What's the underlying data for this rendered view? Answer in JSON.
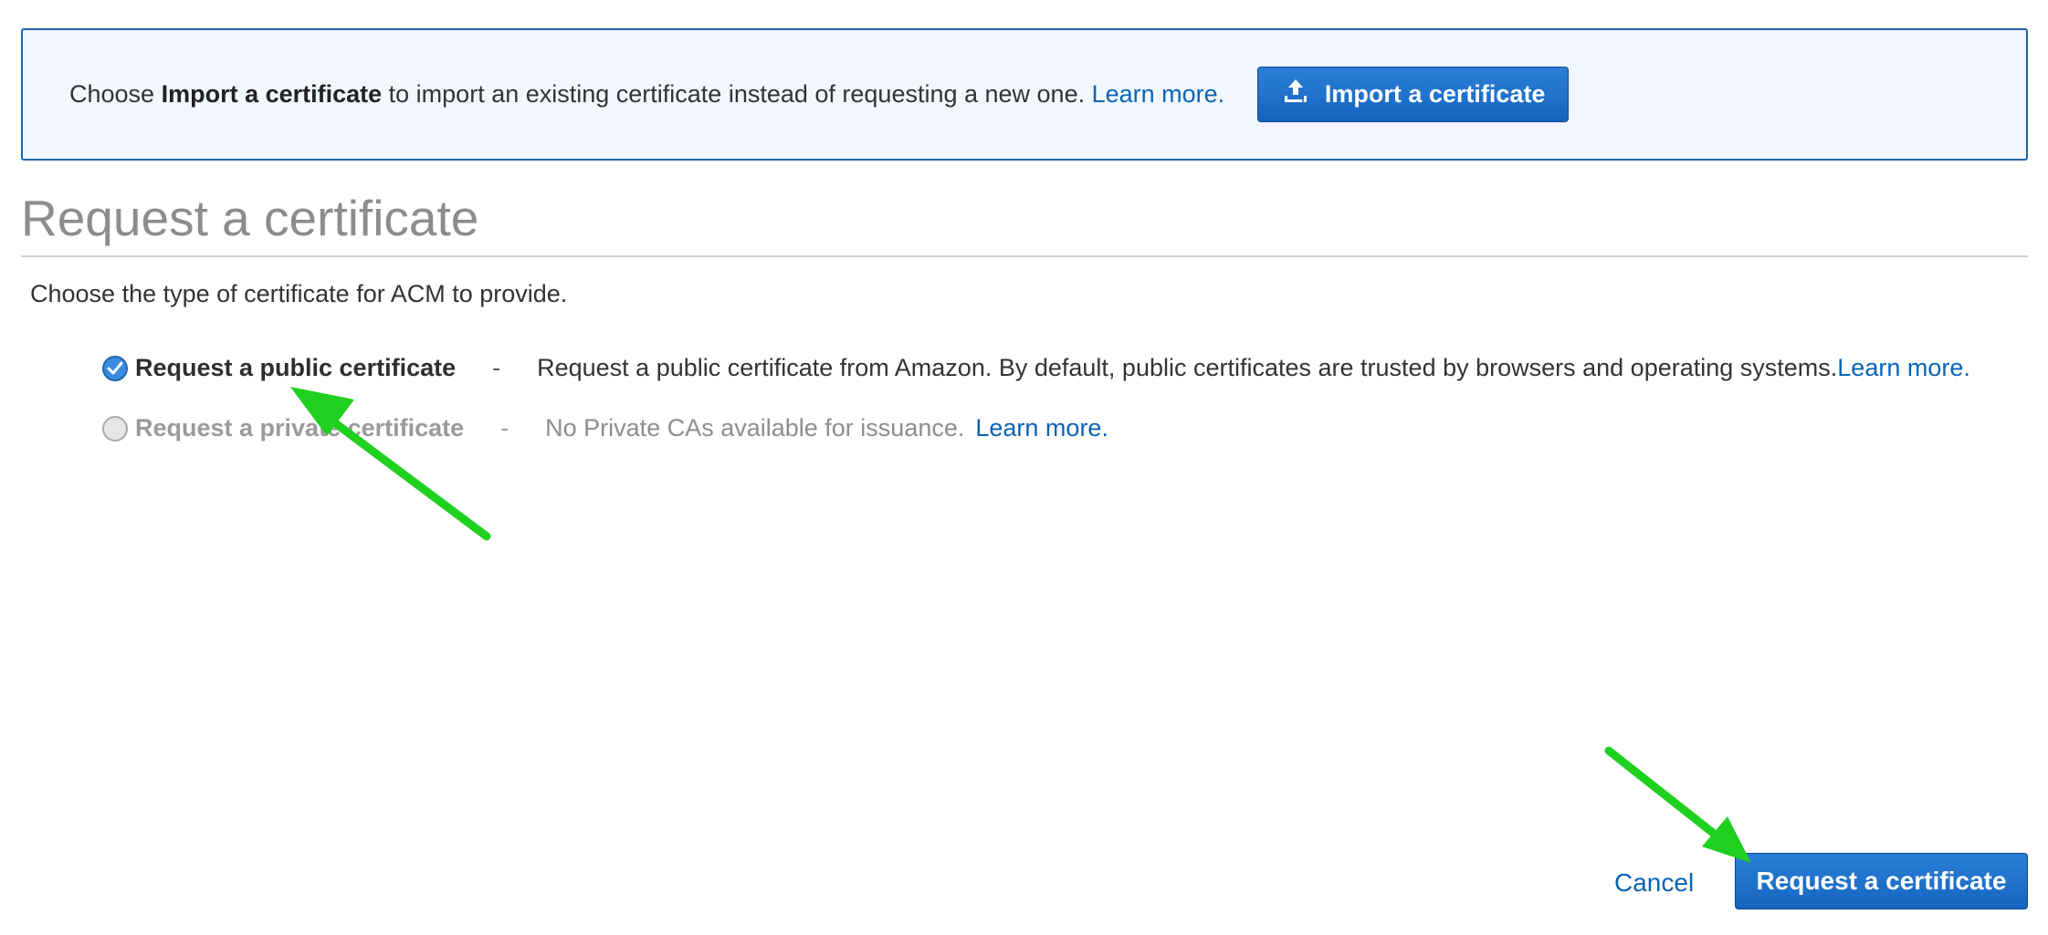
{
  "banner": {
    "prefix": "Choose ",
    "strong": "Import a certificate",
    "suffix": " to import an existing certificate instead of requesting a new one. ",
    "learn_more": "Learn more.",
    "import_button": "Import a certificate"
  },
  "page_title": "Request a certificate",
  "intro": "Choose the type of certificate for ACM to provide.",
  "options": [
    {
      "label": "Request a public certificate",
      "separator": "-",
      "description": "Request a public certificate from Amazon. By default, public certificates are trusted by browsers and operating systems. ",
      "learn_more": "Learn more.",
      "selected": true,
      "disabled": false
    },
    {
      "label": "Request a private certificate",
      "separator": "-",
      "description": "No Private CAs available for issuance.",
      "learn_more": "Learn more.",
      "selected": false,
      "disabled": true
    }
  ],
  "footer": {
    "cancel": "Cancel",
    "request_button": "Request a certificate"
  },
  "colors": {
    "primary_button": "#1565c0",
    "link": "#0a63b5",
    "banner_bg": "#f1f7fd",
    "annotation_arrow": "#1fd01f"
  },
  "icons": {
    "import": "upload-icon",
    "selected_radio": "checkmark-icon"
  }
}
